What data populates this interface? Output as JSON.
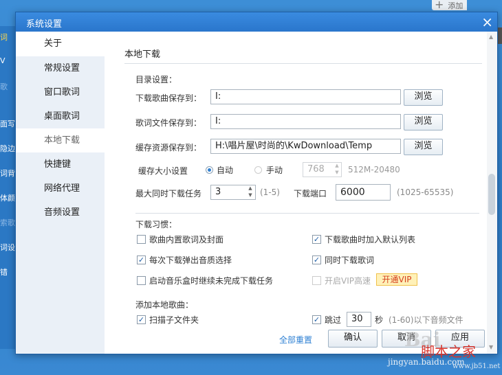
{
  "background": {
    "add_button": "添加",
    "left_items": [
      "词",
      "V",
      "歌",
      "面写",
      "隐边",
      "词背",
      "体颜",
      "索歌",
      "词设",
      "错"
    ],
    "watermark_baidu": "Bai",
    "watermark_site_cn": "脚本之家",
    "watermark_url": "jingyan.baidu.com",
    "watermark_url2": "www.jb51.net"
  },
  "dialog": {
    "title": "系统设置",
    "close_label": "×"
  },
  "sidebar": {
    "items": [
      {
        "label": "关于"
      },
      {
        "label": "常规设置"
      },
      {
        "label": "窗口歌词"
      },
      {
        "label": "桌面歌词"
      },
      {
        "label": "本地下载",
        "active": true
      },
      {
        "label": "快捷键"
      },
      {
        "label": "网络代理"
      },
      {
        "label": "音频设置"
      }
    ]
  },
  "content": {
    "section_title": "本地下载",
    "dir_settings": {
      "heading": "目录设置：",
      "song_label": "下载歌曲保存到：",
      "song_path": "I:",
      "lyric_label": "歌词文件保存到：",
      "lyric_path": "I:",
      "cache_label": "缓存资源保存到：",
      "cache_path": "H:\\唱片屋\\时尚的\\KwDownload\\Temp",
      "browse_label": "浏览"
    },
    "cache_size": {
      "label": "缓存大小设置",
      "auto_label": "自动",
      "manual_label": "手动",
      "value": "768",
      "range": "512M-20480"
    },
    "max_tasks": {
      "label": "最大同时下载任务",
      "value": "3",
      "range": "(1-5)"
    },
    "port": {
      "label": "下载端口",
      "value": "6000",
      "range": "(1025-65535)"
    },
    "habits": {
      "heading": "下载习惯：",
      "options": [
        {
          "label": "歌曲内置歌词及封面",
          "checked": false
        },
        {
          "label": "下载歌曲时加入默认列表",
          "checked": true
        },
        {
          "label": "每次下载弹出音质选择",
          "checked": true
        },
        {
          "label": "同时下载歌词",
          "checked": true
        },
        {
          "label": "启动音乐盒时继续未完成下载任务",
          "checked": false
        },
        {
          "label": "开启VIP高速",
          "checked": false,
          "disabled": true
        }
      ],
      "vip_button": "开通VIP"
    },
    "add_local": {
      "heading": "添加本地歌曲：",
      "scan_subfolders": "扫描子文件夹",
      "skip_label": "跳过",
      "skip_value": "30",
      "skip_suffix": "秒",
      "skip_hint": "(1-60)以下音频文件"
    },
    "footer": {
      "reset_all": "全部重置",
      "ok": "确认",
      "cancel": "取消",
      "apply": "应用"
    }
  },
  "colors": {
    "titlebar": "#2f80d6",
    "link": "#2c7fd3",
    "vip_bg": "#fff1b8"
  }
}
